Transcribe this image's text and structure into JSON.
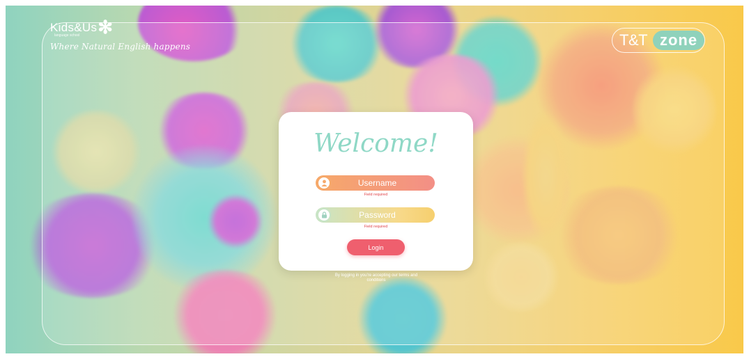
{
  "brand": {
    "name": "Kids&Us",
    "sub": "language school",
    "tagline": "Where Natural English happens"
  },
  "tt_logo": {
    "tt": "T&T",
    "zone": "zone"
  },
  "login_card": {
    "title": "Welcome!",
    "username_placeholder": "Username",
    "username_error": "Field required",
    "password_placeholder": "Password",
    "password_error": "Field required",
    "login_button": "Login"
  },
  "terms_text": "By logging in you're accepting our terms and conditions",
  "colors": {
    "accent": "#ef5f6e",
    "mint": "#8fd8c6",
    "background_left": "#8fd3bf",
    "background_right": "#f9c94a"
  },
  "icons": {
    "username": "user-icon",
    "password": "lock-icon"
  }
}
